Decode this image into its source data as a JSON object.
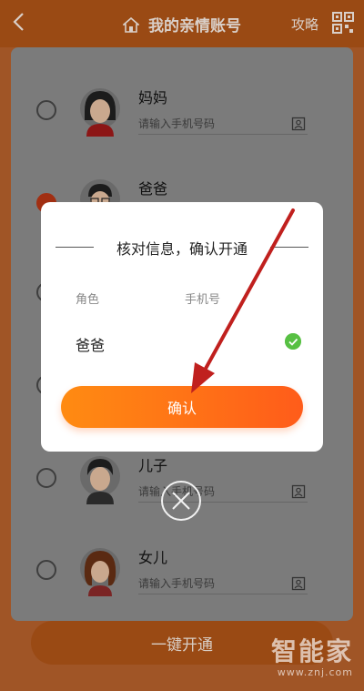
{
  "header": {
    "title": "我的亲情账号",
    "guide": "攻略",
    "back_icon": "chevron-left-icon",
    "qr_icon": "qr-code-icon"
  },
  "members": [
    {
      "name": "妈妈",
      "placeholder": "请输入手机号码",
      "selected": false,
      "avatar": "mother-avatar"
    },
    {
      "name": "爸爸",
      "placeholder": "",
      "selected": true,
      "avatar": "father-avatar"
    },
    {
      "name": "儿子",
      "placeholder": "请输入手机号码",
      "selected": false,
      "avatar": "son-avatar"
    },
    {
      "name": "女儿",
      "placeholder": "请输入手机号码",
      "selected": false,
      "avatar": "daughter-avatar"
    }
  ],
  "open_all_label": "一键开通",
  "dialog": {
    "title": "核对信息，确认开通",
    "col_role": "角色",
    "col_phone": "手机号",
    "row_role": "爸爸",
    "confirm_label": "确认"
  },
  "watermark": {
    "main": "智能家",
    "url": "www.znj.com"
  },
  "colors": {
    "accent": "#ff7a14",
    "check": "#57c043",
    "arrow": "#c0201e"
  }
}
